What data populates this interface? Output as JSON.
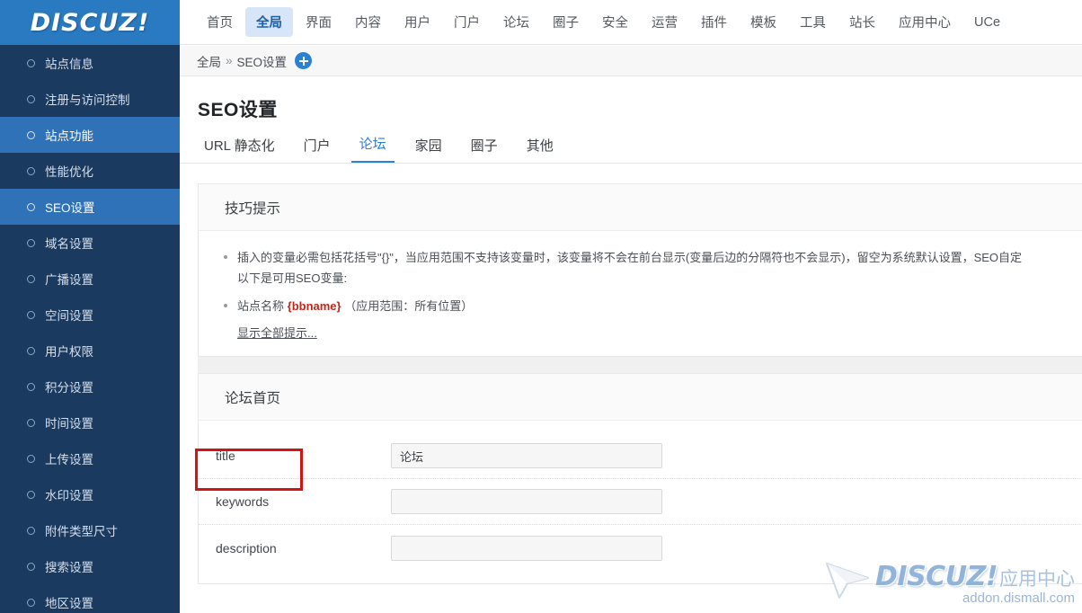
{
  "brand": {
    "logo_text": "DISCUZ!"
  },
  "topnav": {
    "items": [
      {
        "label": "首页",
        "active": false
      },
      {
        "label": "全局",
        "active": true
      },
      {
        "label": "界面",
        "active": false
      },
      {
        "label": "内容",
        "active": false
      },
      {
        "label": "用户",
        "active": false
      },
      {
        "label": "门户",
        "active": false
      },
      {
        "label": "论坛",
        "active": false
      },
      {
        "label": "圈子",
        "active": false
      },
      {
        "label": "安全",
        "active": false
      },
      {
        "label": "运营",
        "active": false
      },
      {
        "label": "插件",
        "active": false
      },
      {
        "label": "模板",
        "active": false
      },
      {
        "label": "工具",
        "active": false
      },
      {
        "label": "站长",
        "active": false
      },
      {
        "label": "应用中心",
        "active": false
      },
      {
        "label": "UCe",
        "active": false
      }
    ]
  },
  "sidebar": {
    "items": [
      {
        "label": "站点信息",
        "state": "normal"
      },
      {
        "label": "注册与访问控制",
        "state": "normal"
      },
      {
        "label": "站点功能",
        "state": "hover"
      },
      {
        "label": "性能优化",
        "state": "normal"
      },
      {
        "label": "SEO设置",
        "state": "active"
      },
      {
        "label": "域名设置",
        "state": "normal"
      },
      {
        "label": "广播设置",
        "state": "normal"
      },
      {
        "label": "空间设置",
        "state": "normal"
      },
      {
        "label": "用户权限",
        "state": "normal"
      },
      {
        "label": "积分设置",
        "state": "normal"
      },
      {
        "label": "时间设置",
        "state": "normal"
      },
      {
        "label": "上传设置",
        "state": "normal"
      },
      {
        "label": "水印设置",
        "state": "normal"
      },
      {
        "label": "附件类型尺寸",
        "state": "normal"
      },
      {
        "label": "搜索设置",
        "state": "normal"
      },
      {
        "label": "地区设置",
        "state": "normal"
      }
    ]
  },
  "breadcrumb": {
    "root": "全局",
    "separator": "»",
    "current": "SEO设置"
  },
  "page": {
    "title": "SEO设置"
  },
  "tabs": [
    {
      "label": "URL 静态化",
      "active": false
    },
    {
      "label": "门户",
      "active": false
    },
    {
      "label": "论坛",
      "active": true
    },
    {
      "label": "家园",
      "active": false
    },
    {
      "label": "圈子",
      "active": false
    },
    {
      "label": "其他",
      "active": false
    }
  ],
  "tips_panel": {
    "title": "技巧提示",
    "bullet1_line1": "插入的变量必需包括花括号\"{}\"，当应用范围不支持该变量时，该变量将不会在前台显示(变量后边的分隔符也不会显示)，留空为系统默认设置，SEO自定",
    "bullet1_line2": "以下是可用SEO变量:",
    "bullet2_prefix": "站点名称",
    "bullet2_var": "{bbname}",
    "bullet2_suffix": "（应用范围：所有位置）",
    "show_all_link": "显示全部提示..."
  },
  "form_panel": {
    "title": "论坛首页",
    "rows": [
      {
        "label": "title",
        "value": "论坛",
        "placeholder": "",
        "highlighted": true
      },
      {
        "label": "keywords",
        "value": "",
        "placeholder": "",
        "highlighted": false
      },
      {
        "label": "description",
        "value": "",
        "placeholder": "",
        "highlighted": false
      }
    ]
  },
  "watermark": {
    "brand": "DISCUZ!",
    "suffix": "应用中心",
    "url": "addon.dismall.com"
  },
  "colors": {
    "brand_blue": "#2a7ac2",
    "sidebar_bg": "#1b3a60",
    "sidebar_active": "#2f72b8",
    "accent": "#2b7fd4",
    "annotation_red": "#d01515",
    "var_red": "#c0271c"
  }
}
